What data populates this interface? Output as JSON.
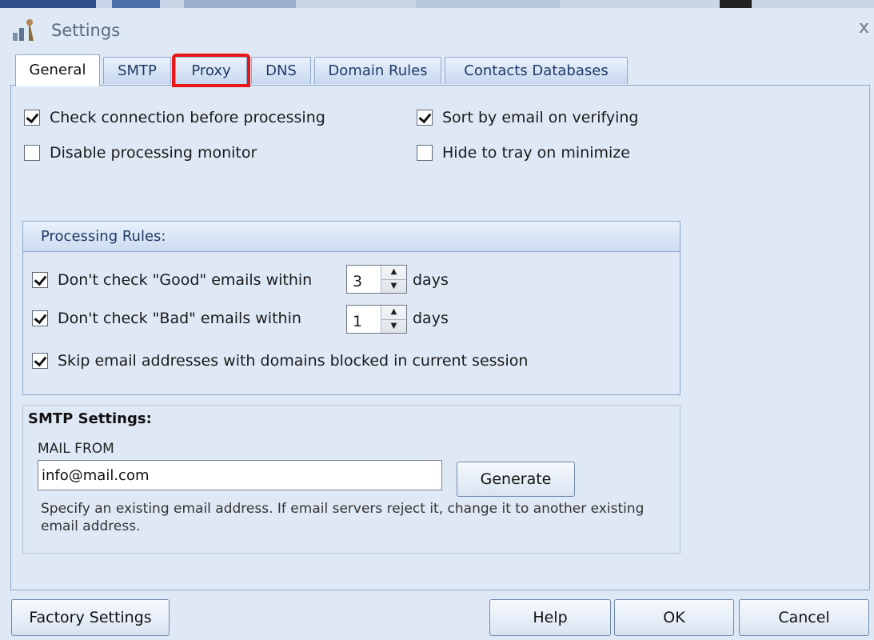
{
  "window": {
    "title": "Settings",
    "close_glyph": "x"
  },
  "tabs": [
    {
      "label": "General",
      "active": true
    },
    {
      "label": "SMTP"
    },
    {
      "label": "Proxy",
      "highlighted": true
    },
    {
      "label": "DNS"
    },
    {
      "label": "Domain Rules"
    },
    {
      "label": "Contacts Databases"
    }
  ],
  "general": {
    "check_connection": {
      "label": "Check connection before processing",
      "checked": true
    },
    "disable_monitor": {
      "label": "Disable processing monitor",
      "checked": false
    },
    "sort_by_email": {
      "label": "Sort by email on verifying",
      "checked": true
    },
    "hide_to_tray": {
      "label": "Hide to tray on minimize",
      "checked": false
    }
  },
  "processing_rules": {
    "header": "Processing Rules:",
    "good": {
      "label": "Don't check \"Good\" emails within",
      "value": "3",
      "suffix": "days",
      "checked": true
    },
    "bad": {
      "label": "Don't check \"Bad\" emails within",
      "value": "1",
      "suffix": "days",
      "checked": true
    },
    "skip_blocked": {
      "label": "Skip email addresses with domains blocked in current session",
      "checked": true
    }
  },
  "smtp": {
    "title": "SMTP Settings:",
    "mail_from_label": "MAIL FROM",
    "mail_from_value": "info@mail.com",
    "generate_label": "Generate",
    "hint": "Specify an existing email address. If  email servers reject it, change it to another existing email address."
  },
  "footer": {
    "factory_label": "Factory Settings",
    "help_label": "Help",
    "ok_label": "OK",
    "cancel_label": "Cancel"
  },
  "colors": {
    "highlight": "#e81717",
    "accent": "#1f3a66",
    "background": "#dfe8f5"
  }
}
